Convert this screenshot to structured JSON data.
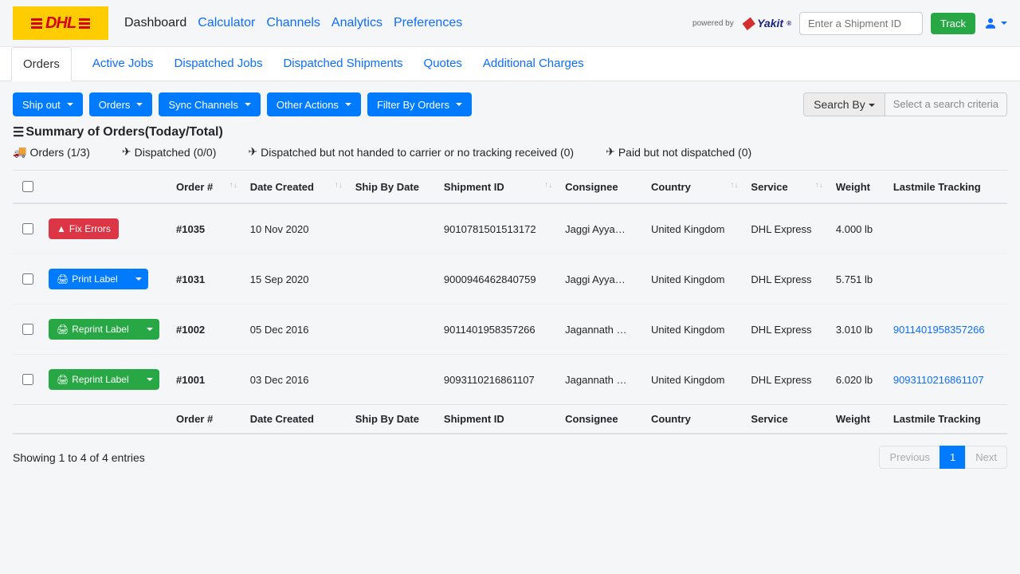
{
  "header": {
    "logo_text": "DHL",
    "nav": [
      "Dashboard",
      "Calculator",
      "Channels",
      "Analytics",
      "Preferences"
    ],
    "powered_by": "powered by",
    "brand": "Yakit",
    "shipment_placeholder": "Enter a Shipment ID",
    "track": "Track"
  },
  "subtabs": [
    "Orders",
    "Active Jobs",
    "Dispatched Jobs",
    "Dispatched Shipments",
    "Quotes",
    "Additional Charges"
  ],
  "actions": {
    "ship_out": "Ship out",
    "orders": "Orders",
    "sync": "Sync Channels",
    "other": "Other Actions",
    "filter": "Filter By Orders",
    "search_by": "Search By",
    "search_placeholder": "Select a search criteria"
  },
  "summary": {
    "title": "Summary of Orders(Today/Total)",
    "orders": "Orders (1/3)",
    "dispatched": "Dispatched (0/0)",
    "not_handed": "Dispatched but not handed to carrier or no tracking received (0)",
    "paid_not_dispatched": "Paid but not dispatched (0)"
  },
  "columns": [
    "Order #",
    "Date Created",
    "Ship By Date",
    "Shipment ID",
    "Consignee",
    "Country",
    "Service",
    "Weight",
    "Lastmile Tracking"
  ],
  "rows": [
    {
      "action": "Fix Errors",
      "action_type": "red",
      "order": "#1035",
      "date": "10 Nov 2020",
      "shipby": "",
      "shipment": "9010781501513172",
      "consignee": "Jaggi Ayya…",
      "country": "United Kingdom",
      "service": "DHL Express",
      "weight": "4.000 lb",
      "tracking": ""
    },
    {
      "action": "Print Label",
      "action_type": "blue",
      "order": "#1031",
      "date": "15 Sep 2020",
      "shipby": "",
      "shipment": "9000946462840759",
      "consignee": "Jaggi Ayya…",
      "country": "United Kingdom",
      "service": "DHL Express",
      "weight": "5.751 lb",
      "tracking": ""
    },
    {
      "action": "Reprint Label",
      "action_type": "green",
      "order": "#1002",
      "date": "05 Dec 2016",
      "shipby": "",
      "shipment": "9011401958357266",
      "consignee": "Jagannath …",
      "country": "United Kingdom",
      "service": "DHL Express",
      "weight": "3.010 lb",
      "tracking": "9011401958357266"
    },
    {
      "action": "Reprint Label",
      "action_type": "green",
      "order": "#1001",
      "date": "03 Dec 2016",
      "shipby": "",
      "shipment": "9093110216861107",
      "consignee": "Jagannath …",
      "country": "United Kingdom",
      "service": "DHL Express",
      "weight": "6.020 lb",
      "tracking": "9093110216861107"
    }
  ],
  "footer": {
    "showing": "Showing 1 to 4 of 4 entries",
    "prev": "Previous",
    "page": "1",
    "next": "Next"
  }
}
